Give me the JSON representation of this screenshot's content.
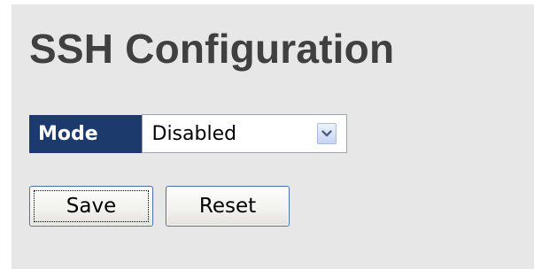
{
  "page": {
    "title": "SSH Configuration"
  },
  "form": {
    "mode_label": "Mode",
    "mode_value": "Disabled",
    "mode_options": [
      "Disabled"
    ]
  },
  "buttons": {
    "save_label": "Save",
    "reset_label": "Reset"
  },
  "icons": {
    "dropdown": "chevron-down-icon"
  },
  "colors": {
    "panel_background": "#e7e7e7",
    "label_background": "#1c3a6b",
    "label_text": "#ffffff",
    "title_text": "#404040",
    "button_border": "#4a6fa8"
  }
}
